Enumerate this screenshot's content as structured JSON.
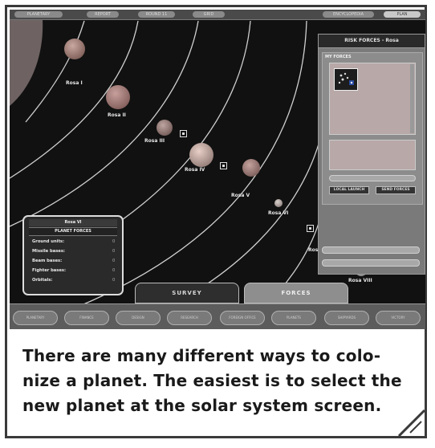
{
  "top_menu": {
    "items": [
      "PLANETARY",
      "REPORT",
      "ROUND 11",
      "GRID",
      "ENCYCLOPEDIA",
      "PLAN"
    ]
  },
  "planets": [
    {
      "name": "Rosa I"
    },
    {
      "name": "Rosa II"
    },
    {
      "name": "Rosa III"
    },
    {
      "name": "Rosa IV"
    },
    {
      "name": "Rosa V"
    },
    {
      "name": "Rosa VI"
    },
    {
      "name": "Rosa VII"
    },
    {
      "name": "Rosa VIII"
    }
  ],
  "risk_panel": {
    "title": "RISK FORCES - Rosa",
    "my_forces_label": "MY FORCES",
    "buttons": [
      "LOCAL LAUNCH",
      "SEND FORCES"
    ]
  },
  "planet_forces": {
    "planet_name": "Rosa VI",
    "header": "PLANET FORCES",
    "rows": [
      {
        "label": "Ground units:",
        "value": "0"
      },
      {
        "label": "Missile bases:",
        "value": "0"
      },
      {
        "label": "Beam bases:",
        "value": "0"
      },
      {
        "label": "Fighter bases:",
        "value": "0"
      },
      {
        "label": "Orbitals:",
        "value": "0"
      }
    ]
  },
  "view_tabs": {
    "survey": "SURVEY",
    "forces": "FORCES"
  },
  "nav_buttons": [
    "PLANETARY",
    "FINANCE",
    "DESIGN",
    "RESEARCH",
    "FOREIGN OFFICE",
    "PLANETS",
    "SHIPYARDS",
    "VICTORY"
  ],
  "caption": {
    "lines": [
      "There are many different ways to colo-",
      "nize a planet. The easiest is to select the",
      "new planet at the solar system screen."
    ]
  },
  "colors": {
    "frame": "#3a3a3a",
    "screen_bg": "#111111",
    "caption_text": "#1a1a1a"
  }
}
